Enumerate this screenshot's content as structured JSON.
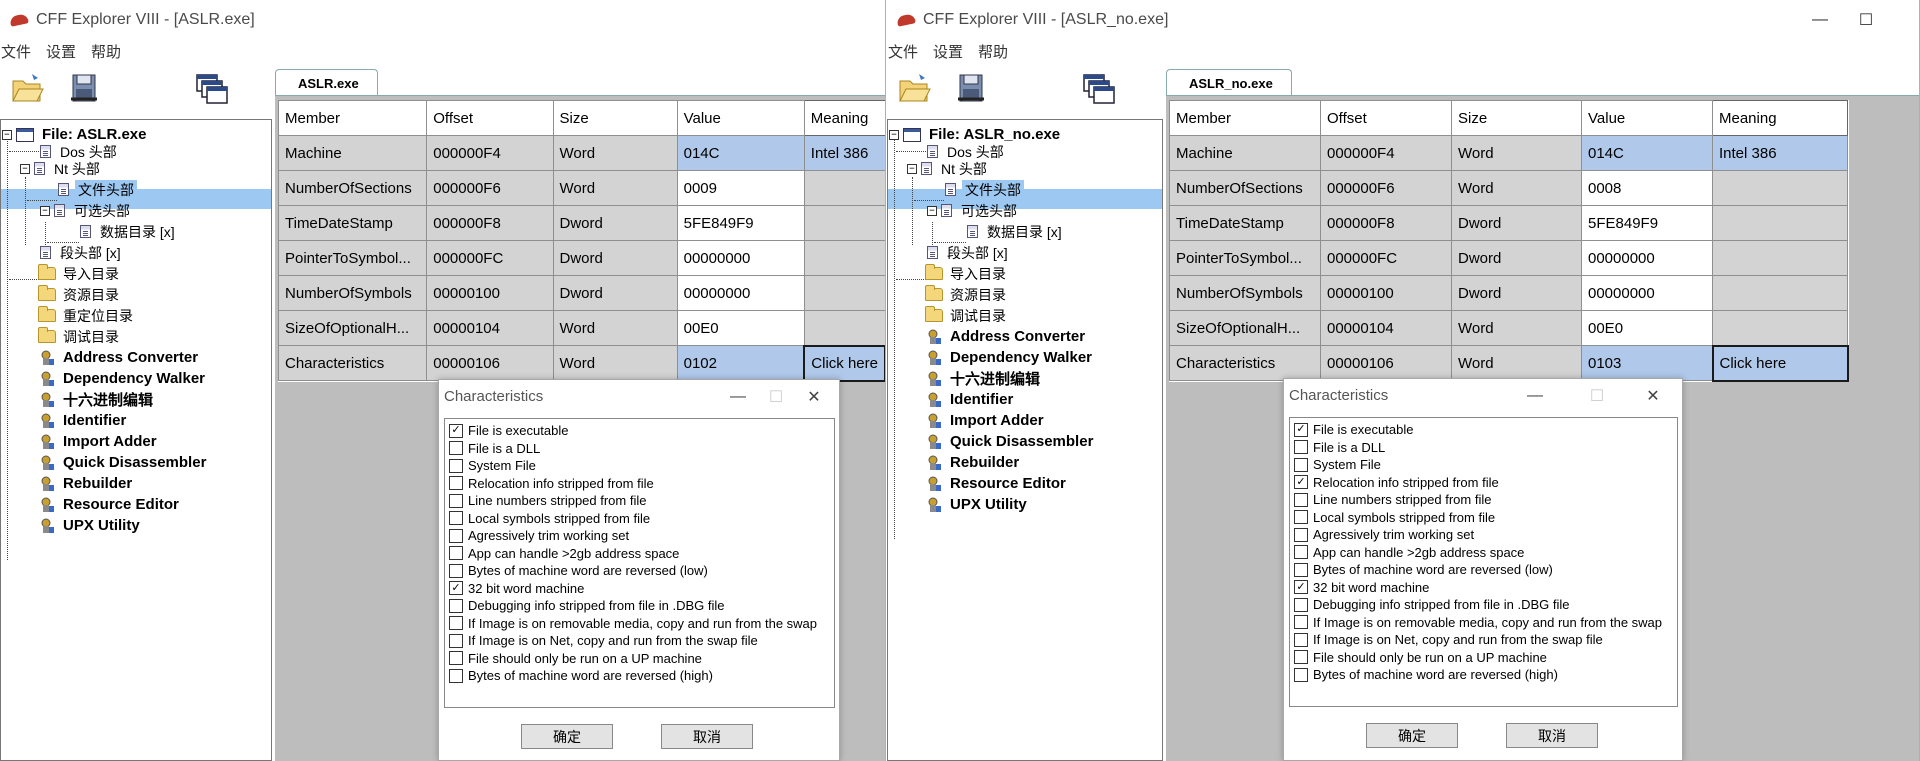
{
  "windows": [
    {
      "title": "CFF Explorer VIII - [ASLR.exe]",
      "menu": [
        "文件",
        "设置",
        "帮助"
      ],
      "tab": "ASLR.exe",
      "tree": [
        {
          "label": "File: ASLR.exe",
          "icon": "file-window-icon"
        },
        {
          "label": "Dos 头部",
          "icon": "document-icon"
        },
        {
          "label": "Nt 头部",
          "icon": "document-icon"
        },
        {
          "label": "文件头部",
          "icon": "document-icon"
        },
        {
          "label": "可选头部",
          "icon": "document-icon"
        },
        {
          "label": "数据目录 [x]",
          "icon": "document-icon"
        },
        {
          "label": "段头部 [x]",
          "icon": "document-icon"
        },
        {
          "label": "导入目录",
          "icon": "folder-icon"
        },
        {
          "label": "资源目录",
          "icon": "folder-icon"
        },
        {
          "label": "重定位目录",
          "icon": "folder-icon"
        },
        {
          "label": "调试目录",
          "icon": "folder-icon"
        },
        {
          "label": "Address Converter",
          "icon": "tool-icon"
        },
        {
          "label": "Dependency Walker",
          "icon": "tool-icon"
        },
        {
          "label": "十六进制编辑",
          "icon": "tool-icon"
        },
        {
          "label": "Identifier",
          "icon": "tool-icon"
        },
        {
          "label": "Import Adder",
          "icon": "tool-icon"
        },
        {
          "label": "Quick Disassembler",
          "icon": "tool-icon"
        },
        {
          "label": "Rebuilder",
          "icon": "tool-icon"
        },
        {
          "label": "Resource Editor",
          "icon": "tool-icon"
        },
        {
          "label": "UPX Utility",
          "icon": "tool-icon"
        }
      ],
      "columns": [
        "Member",
        "Offset",
        "Size",
        "Value",
        "Meaning"
      ],
      "rows": [
        [
          "Machine",
          "000000F4",
          "Word",
          "014C",
          "Intel 386"
        ],
        [
          "NumberOfSections",
          "000000F6",
          "Word",
          "0009",
          ""
        ],
        [
          "TimeDateStamp",
          "000000F8",
          "Dword",
          "5FE849F9",
          ""
        ],
        [
          "PointerToSymbol...",
          "000000FC",
          "Dword",
          "00000000",
          ""
        ],
        [
          "NumberOfSymbols",
          "00000100",
          "Dword",
          "00000000",
          ""
        ],
        [
          "SizeOfOptionalH...",
          "00000104",
          "Word",
          "00E0",
          ""
        ],
        [
          "Characteristics",
          "00000106",
          "Word",
          "0102",
          "Click here"
        ]
      ],
      "dialog": {
        "title": "Characteristics",
        "ok": "确定",
        "cancel": "取消",
        "flags": [
          {
            "label": "File is executable",
            "checked": true
          },
          {
            "label": "File is a DLL",
            "checked": false
          },
          {
            "label": "System File",
            "checked": false
          },
          {
            "label": "Relocation info stripped from file",
            "checked": false
          },
          {
            "label": "Line numbers stripped from file",
            "checked": false
          },
          {
            "label": "Local symbols stripped from file",
            "checked": false
          },
          {
            "label": "Agressively trim working set",
            "checked": false
          },
          {
            "label": "App can handle >2gb address space",
            "checked": false
          },
          {
            "label": "Bytes of machine word are reversed (low)",
            "checked": false
          },
          {
            "label": "32 bit word machine",
            "checked": true
          },
          {
            "label": "Debugging info stripped from file in .DBG file",
            "checked": false
          },
          {
            "label": "If Image is on removable media, copy and run from the swap",
            "checked": false
          },
          {
            "label": "If Image is on Net, copy and run from the swap file",
            "checked": false
          },
          {
            "label": "File should only be run on a UP machine",
            "checked": false
          },
          {
            "label": "Bytes of machine word are reversed (high)",
            "checked": false
          }
        ]
      }
    },
    {
      "title": "CFF Explorer VIII - [ASLR_no.exe]",
      "menu": [
        "文件",
        "设置",
        "帮助"
      ],
      "tab": "ASLR_no.exe",
      "tree": [
        {
          "label": "File: ASLR_no.exe",
          "icon": "file-window-icon"
        },
        {
          "label": "Dos 头部",
          "icon": "document-icon"
        },
        {
          "label": "Nt 头部",
          "icon": "document-icon"
        },
        {
          "label": "文件头部",
          "icon": "document-icon"
        },
        {
          "label": "可选头部",
          "icon": "document-icon"
        },
        {
          "label": "数据目录 [x]",
          "icon": "document-icon"
        },
        {
          "label": "段头部 [x]",
          "icon": "document-icon"
        },
        {
          "label": "导入目录",
          "icon": "folder-icon"
        },
        {
          "label": "资源目录",
          "icon": "folder-icon"
        },
        {
          "label": "调试目录",
          "icon": "folder-icon"
        },
        {
          "label": "Address Converter",
          "icon": "tool-icon"
        },
        {
          "label": "Dependency Walker",
          "icon": "tool-icon"
        },
        {
          "label": "十六进制编辑",
          "icon": "tool-icon"
        },
        {
          "label": "Identifier",
          "icon": "tool-icon"
        },
        {
          "label": "Import Adder",
          "icon": "tool-icon"
        },
        {
          "label": "Quick Disassembler",
          "icon": "tool-icon"
        },
        {
          "label": "Rebuilder",
          "icon": "tool-icon"
        },
        {
          "label": "Resource Editor",
          "icon": "tool-icon"
        },
        {
          "label": "UPX Utility",
          "icon": "tool-icon"
        }
      ],
      "columns": [
        "Member",
        "Offset",
        "Size",
        "Value",
        "Meaning"
      ],
      "rows": [
        [
          "Machine",
          "000000F4",
          "Word",
          "014C",
          "Intel 386"
        ],
        [
          "NumberOfSections",
          "000000F6",
          "Word",
          "0008",
          ""
        ],
        [
          "TimeDateStamp",
          "000000F8",
          "Dword",
          "5FE849F9",
          ""
        ],
        [
          "PointerToSymbol...",
          "000000FC",
          "Dword",
          "00000000",
          ""
        ],
        [
          "NumberOfSymbols",
          "00000100",
          "Dword",
          "00000000",
          ""
        ],
        [
          "SizeOfOptionalH...",
          "00000104",
          "Word",
          "00E0",
          ""
        ],
        [
          "Characteristics",
          "00000106",
          "Word",
          "0103",
          "Click here"
        ]
      ],
      "dialog": {
        "title": "Characteristics",
        "ok": "确定",
        "cancel": "取消",
        "flags": [
          {
            "label": "File is executable",
            "checked": true
          },
          {
            "label": "File is a DLL",
            "checked": false
          },
          {
            "label": "System File",
            "checked": false
          },
          {
            "label": "Relocation info stripped from file",
            "checked": true
          },
          {
            "label": "Line numbers stripped from file",
            "checked": false
          },
          {
            "label": "Local symbols stripped from file",
            "checked": false
          },
          {
            "label": "Agressively trim working set",
            "checked": false
          },
          {
            "label": "App can handle >2gb address space",
            "checked": false
          },
          {
            "label": "Bytes of machine word are reversed (low)",
            "checked": false
          },
          {
            "label": "32 bit word machine",
            "checked": true
          },
          {
            "label": "Debugging info stripped from file in .DBG file",
            "checked": false
          },
          {
            "label": "If Image is on removable media, copy and run from the swap",
            "checked": false
          },
          {
            "label": "If Image is on Net, copy and run from the swap file",
            "checked": false
          },
          {
            "label": "File should only be run on a UP machine",
            "checked": false
          },
          {
            "label": "Bytes of machine word are reversed (high)",
            "checked": false
          }
        ]
      }
    }
  ],
  "colors": {
    "selection": "#9cc8f2",
    "value_highlight": "#b0c8ea",
    "panel_gray": "#bdbdbd",
    "cell_gray": "#d3d3d3"
  }
}
